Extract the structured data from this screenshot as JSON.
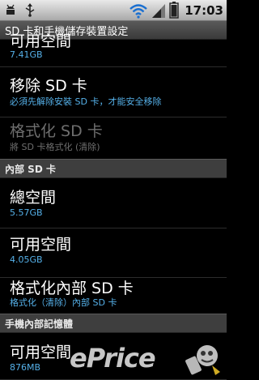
{
  "statusbar": {
    "time": "17:03",
    "icons": [
      "android-debug-icon",
      "usb-icon",
      "wifi-icon",
      "signal-icon",
      "battery-icon"
    ]
  },
  "title": "SD 卡和手機儲存裝置設定",
  "items": [
    {
      "title": "可用空間",
      "summary": "7.41GB"
    },
    {
      "title": "移除 SD 卡",
      "summary": "必須先解除安裝 SD 卡，才能安全移除"
    },
    {
      "title": "格式化 SD 卡",
      "summary": "將 SD 卡格式化 (清除)"
    }
  ],
  "section_internal_sd": "內部 SD 卡",
  "internal_items": [
    {
      "title": "總空間",
      "summary": "5.57GB"
    },
    {
      "title": "可用空間",
      "summary": "4.05GB"
    },
    {
      "title": "格式化內部 SD 卡",
      "summary": "格式化（清除）內部 SD 卡"
    }
  ],
  "section_phone_memory": "手機內部記憶體",
  "phone_items": [
    {
      "title": "可用空間",
      "summary": "876MB"
    }
  ],
  "watermark": "ePrice",
  "colors": {
    "summary": "#55b0e8",
    "disabled": "#6e6e6e",
    "header_bg": "#3e3e3e"
  }
}
